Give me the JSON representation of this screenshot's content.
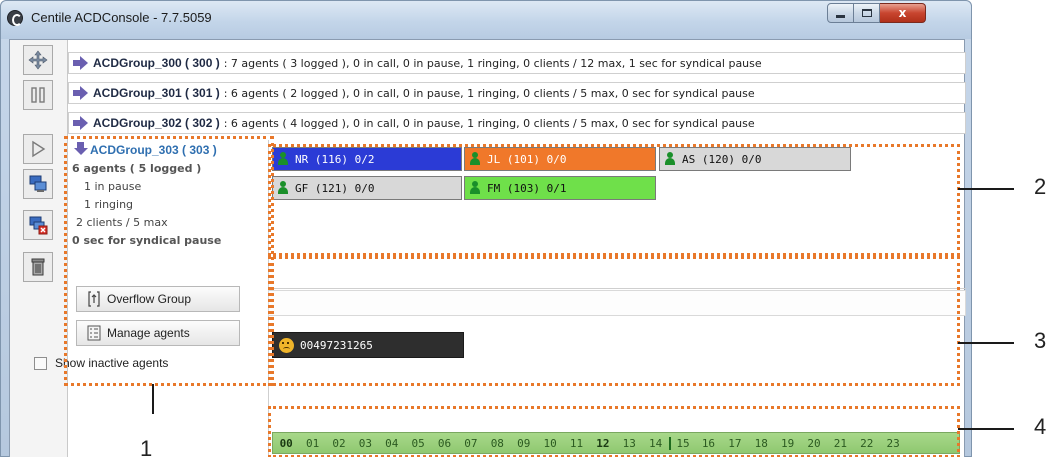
{
  "window": {
    "title": "Centile ACDConsole - 7.7.5059",
    "controls": [
      "minimize-icon",
      "maximize-icon",
      "close-icon"
    ],
    "close_glyph": "x"
  },
  "toolbar": {
    "icons": [
      "move-arrows-icon",
      "pause-icon",
      "play-icon",
      "computer-icon",
      "computer-remove-icon",
      "trash-icon"
    ]
  },
  "groups": [
    {
      "name": "ACDGroup_300 ( 300 )",
      "details": ": 7 agents ( 3 logged ),  0 in call,  0 in pause,  1 ringing, 0 clients / 12 max, 1 sec for syndical pause"
    },
    {
      "name": "ACDGroup_301 ( 301 )",
      "details": ": 6 agents ( 2 logged ),  0 in call,  0 in pause,  1 ringing, 0 clients / 5 max, 0 sec for syndical pause"
    },
    {
      "name": "ACDGroup_302 ( 302 )",
      "details": ": 6 agents ( 4 logged ),  0 in call,  0 in pause,  1 ringing, 0 clients / 5 max, 0 sec for syndical pause"
    }
  ],
  "selected_group": {
    "name": "ACDGroup_303 ( 303 )",
    "agents_line": "6 agents ( 5 logged )",
    "pause_line": "1 in pause",
    "ringing_line": "1 ringing",
    "clients_line": "2 clients / 5 max",
    "syndical_line": "0 sec for syndical pause"
  },
  "actions": {
    "overflow_label": "Overflow Group",
    "manage_label": "Manage agents",
    "show_inactive_label": "Show inactive agents"
  },
  "agents": [
    {
      "label": "NR (116)  0/2",
      "color": "#2b3bd6"
    },
    {
      "label": "JL (101)  0/0",
      "color": "#f0782a"
    },
    {
      "label": "AS (120)  0/0",
      "color": "#d8d8d8"
    },
    {
      "label": "GF (121)  0/0",
      "color": "#d8d8d8"
    },
    {
      "label": "FM (103)  0/1",
      "color": "#6fe04a"
    }
  ],
  "calls": [
    {
      "number": "00497231265"
    }
  ],
  "timeline": {
    "hours": [
      "00",
      "01",
      "02",
      "03",
      "04",
      "05",
      "06",
      "07",
      "08",
      "09",
      "10",
      "11",
      "12",
      "13",
      "14",
      "15",
      "16",
      "17",
      "18",
      "19",
      "20",
      "21",
      "22",
      "23"
    ]
  },
  "callouts": {
    "n1": "1",
    "n2": "2",
    "n3": "3",
    "n4": "4"
  }
}
